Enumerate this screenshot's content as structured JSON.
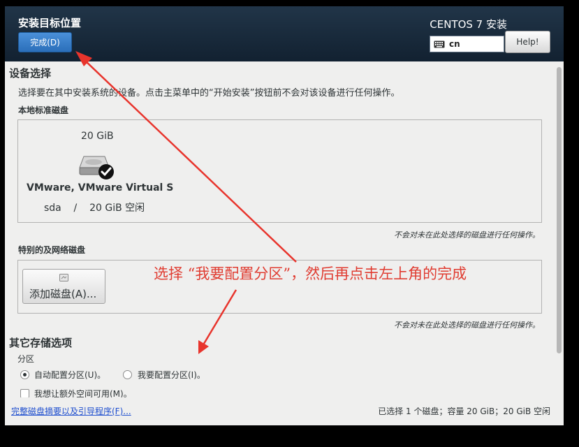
{
  "header": {
    "title": "安装目标位置",
    "done_label": "完成(D)",
    "product": "CENTOS 7 安装",
    "keyboard_layout": "cn",
    "help_label": "Help!"
  },
  "device_selection": {
    "heading": "设备选择",
    "description": "选择要在其中安装系统的设备。点击主菜单中的“开始安装”按钮前不会对该设备进行任何操作。",
    "local_heading": "本地标准磁盘",
    "disk": {
      "size": "20 GiB",
      "name": "VMware, VMware Virtual S",
      "device_info": "sda    /    20 GiB 空闲",
      "selected": true
    },
    "local_note": "不会对未在此处选择的磁盘进行任何操作。",
    "special_heading": "特别的及网络磁盘",
    "add_disk_label": "添加磁盘(A)...",
    "special_note": "不会对未在此处选择的磁盘进行任何操作。"
  },
  "other_storage": {
    "heading": "其它存储选项",
    "partition_heading": "分区",
    "options": [
      {
        "label": "自动配置分区(U)。",
        "selected": true
      },
      {
        "label": "我要配置分区(I)。",
        "selected": false
      }
    ],
    "extra_space_label": "我想让额外空间可用(M)。"
  },
  "footer": {
    "summary_link": "完整磁盘摘要以及引导程序(F)...",
    "status": "已选择 1 个磁盘；容量 20 GiB；20 GiB 空闲"
  },
  "annotation": {
    "text": "选择 “我要配置分区”，然后再点击左上角的完成",
    "color": "#e03c31"
  },
  "colors": {
    "header_bg": "#18293a",
    "accent_blue": "#2b6fba",
    "link": "#1f4fcf"
  }
}
